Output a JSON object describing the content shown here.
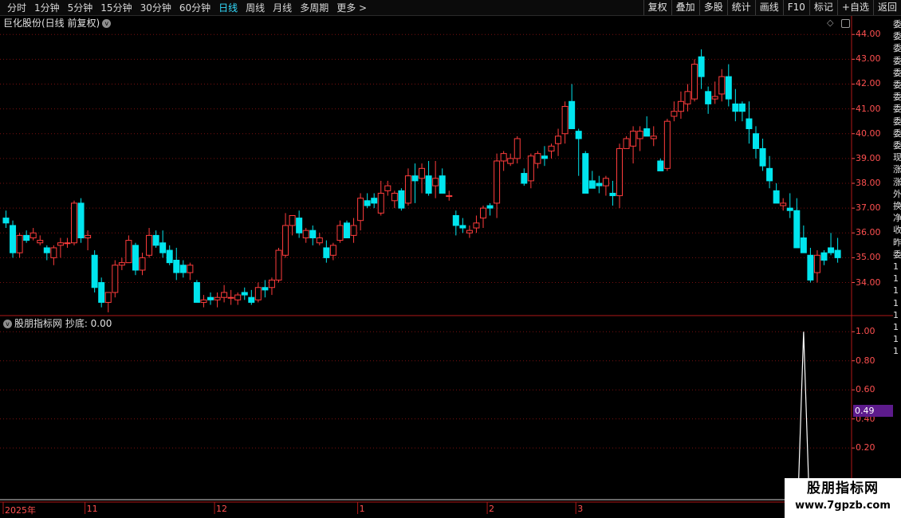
{
  "toolbar": {
    "periods": [
      "分时",
      "1分钟",
      "5分钟",
      "15分钟",
      "30分钟",
      "60分钟",
      "日线",
      "周线",
      "月线",
      "多周期",
      "更多"
    ],
    "active_period": "日线",
    "more_arrow": ">",
    "buttons": [
      "复权",
      "叠加",
      "多股",
      "统计",
      "画线",
      "F10",
      "标记",
      "+自选",
      "返回"
    ]
  },
  "main_chart": {
    "title": "巨化股份(日线 前复权)",
    "chevron": "v"
  },
  "indicator": {
    "title": "股朋指标网 抄底: 0.00",
    "current_value": "0.49"
  },
  "colors": {
    "up": "#ff3c3c",
    "down": "#00e5ee",
    "grid": "#7a1010",
    "axis_text": "#ff5050",
    "line": "#ffffff"
  },
  "watermark": {
    "line1": "股朋指标网",
    "line2": "www.7gpzb.com"
  },
  "side_fragments": [
    "委",
    "委",
    "委",
    "委",
    "委",
    "委",
    "委",
    "委",
    "委",
    "委",
    "委",
    "现",
    "涨",
    "涨",
    "外",
    "换",
    "净",
    "收",
    "昨",
    "委",
    "1",
    "1",
    "1",
    "1",
    "1",
    "1",
    "1",
    "1"
  ],
  "chart_data": [
    {
      "type": "candlestick",
      "title": "巨化股份(日线 前复权)",
      "y_ticks": [
        34.0,
        35.0,
        36.0,
        37.0,
        38.0,
        39.0,
        40.0,
        41.0,
        42.0,
        43.0,
        44.0
      ],
      "ylim": [
        32.7,
        44.2
      ],
      "x_labels": [
        "2025年",
        "11",
        "12",
        "1",
        "2",
        "3"
      ],
      "x_label_index": [
        0,
        12,
        31,
        52,
        71,
        84
      ],
      "candles": [
        [
          36.6,
          36.9,
          36.2,
          36.4
        ],
        [
          36.3,
          36.5,
          35.0,
          35.2
        ],
        [
          35.2,
          36.0,
          35.0,
          35.9
        ],
        [
          35.9,
          36.1,
          35.6,
          35.7
        ],
        [
          35.8,
          36.2,
          35.7,
          36.0
        ],
        [
          35.6,
          35.9,
          35.5,
          35.7
        ],
        [
          35.4,
          35.5,
          34.9,
          35.2
        ],
        [
          35.0,
          35.5,
          34.7,
          35.4
        ],
        [
          35.5,
          35.8,
          35.0,
          35.6
        ],
        [
          35.6,
          35.8,
          35.4,
          35.6
        ],
        [
          35.6,
          37.3,
          35.5,
          37.2
        ],
        [
          37.2,
          37.4,
          35.6,
          35.8
        ],
        [
          35.8,
          36.1,
          35.3,
          35.9
        ],
        [
          35.1,
          35.3,
          33.6,
          33.8
        ],
        [
          34.0,
          34.2,
          33.0,
          33.2
        ],
        [
          33.2,
          33.4,
          32.8,
          33.6
        ],
        [
          33.6,
          34.9,
          33.4,
          34.7
        ],
        [
          34.7,
          35.0,
          34.5,
          34.8
        ],
        [
          34.8,
          35.9,
          34.8,
          35.7
        ],
        [
          35.5,
          35.6,
          34.3,
          34.5
        ],
        [
          34.5,
          35.2,
          34.3,
          35.0
        ],
        [
          35.1,
          36.2,
          35.0,
          35.9
        ],
        [
          35.9,
          36.1,
          35.4,
          35.5
        ],
        [
          35.6,
          36.1,
          35.0,
          35.2
        ],
        [
          35.3,
          35.5,
          34.7,
          34.8
        ],
        [
          34.9,
          35.4,
          34.1,
          34.4
        ],
        [
          34.7,
          34.9,
          34.2,
          34.4
        ],
        [
          34.4,
          34.8,
          34.1,
          34.7
        ],
        [
          34.0,
          34.1,
          33.2,
          33.2
        ],
        [
          33.2,
          33.5,
          33.0,
          33.3
        ],
        [
          33.4,
          33.6,
          33.1,
          33.3
        ],
        [
          33.3,
          33.6,
          33.0,
          33.4
        ],
        [
          33.4,
          33.9,
          33.2,
          33.6
        ],
        [
          33.4,
          33.7,
          33.1,
          33.4
        ],
        [
          33.3,
          33.6,
          33.1,
          33.5
        ],
        [
          33.6,
          33.8,
          33.3,
          33.5
        ],
        [
          33.4,
          33.7,
          33.1,
          33.2
        ],
        [
          33.3,
          34.0,
          33.2,
          33.8
        ],
        [
          33.8,
          34.1,
          33.4,
          33.7
        ],
        [
          33.8,
          34.2,
          33.5,
          34.1
        ],
        [
          34.1,
          35.4,
          34.0,
          35.3
        ],
        [
          35.1,
          36.8,
          35.0,
          36.3
        ],
        [
          36.3,
          36.7,
          35.9,
          36.7
        ],
        [
          36.6,
          36.9,
          35.8,
          36.0
        ],
        [
          35.8,
          36.2,
          35.6,
          36.1
        ],
        [
          36.1,
          36.3,
          35.5,
          35.8
        ],
        [
          35.6,
          36.0,
          35.5,
          35.8
        ],
        [
          35.4,
          35.7,
          34.8,
          35.0
        ],
        [
          35.1,
          35.6,
          34.9,
          35.5
        ],
        [
          35.7,
          36.5,
          35.6,
          36.3
        ],
        [
          36.4,
          36.5,
          35.8,
          35.8
        ],
        [
          35.9,
          36.6,
          35.6,
          36.3
        ],
        [
          36.5,
          37.6,
          36.1,
          37.4
        ],
        [
          37.3,
          37.6,
          37.0,
          37.1
        ],
        [
          37.4,
          37.6,
          37.0,
          37.2
        ],
        [
          36.8,
          38.1,
          36.7,
          37.6
        ],
        [
          37.7,
          38.1,
          37.5,
          37.9
        ],
        [
          37.3,
          37.7,
          37.0,
          37.6
        ],
        [
          37.7,
          37.8,
          36.9,
          37.0
        ],
        [
          37.2,
          38.6,
          37.1,
          38.3
        ],
        [
          38.3,
          38.8,
          37.2,
          38.1
        ],
        [
          38.2,
          38.8,
          37.6,
          38.6
        ],
        [
          38.3,
          38.9,
          37.5,
          37.6
        ],
        [
          37.9,
          38.9,
          37.4,
          38.2
        ],
        [
          38.3,
          38.6,
          37.6,
          37.6
        ],
        [
          37.5,
          37.7,
          37.3,
          37.5
        ],
        [
          36.7,
          36.9,
          35.9,
          36.3
        ],
        [
          36.3,
          36.6,
          36.0,
          36.2
        ],
        [
          36.0,
          36.3,
          35.8,
          36.1
        ],
        [
          36.2,
          36.7,
          36.0,
          36.4
        ],
        [
          36.6,
          37.1,
          36.2,
          37.0
        ],
        [
          37.1,
          37.2,
          36.7,
          37.0
        ],
        [
          37.2,
          39.2,
          36.6,
          38.9
        ],
        [
          38.9,
          39.3,
          38.5,
          39.2
        ],
        [
          38.8,
          39.2,
          38.7,
          39.0
        ],
        [
          39.0,
          39.9,
          38.8,
          39.8
        ],
        [
          38.4,
          38.6,
          37.9,
          38.0
        ],
        [
          38.1,
          39.2,
          37.8,
          39.1
        ],
        [
          38.8,
          39.3,
          38.6,
          39.2
        ],
        [
          39.1,
          39.5,
          38.7,
          39.0
        ],
        [
          39.3,
          39.6,
          39.0,
          39.5
        ],
        [
          39.6,
          40.2,
          39.1,
          39.9
        ],
        [
          40.0,
          41.3,
          39.6,
          41.1
        ],
        [
          41.3,
          42.0,
          41.2,
          40.2
        ],
        [
          40.1,
          40.2,
          38.3,
          39.8
        ],
        [
          39.2,
          39.3,
          37.6,
          37.6
        ],
        [
          38.1,
          38.5,
          37.9,
          37.8
        ],
        [
          38.0,
          38.3,
          37.6,
          37.9
        ],
        [
          37.9,
          38.3,
          37.5,
          38.2
        ],
        [
          37.6,
          38.1,
          37.1,
          37.5
        ],
        [
          37.5,
          39.6,
          37.0,
          39.4
        ],
        [
          39.4,
          39.9,
          39.4,
          39.8
        ],
        [
          39.5,
          40.3,
          38.8,
          40.1
        ],
        [
          39.8,
          40.3,
          39.3,
          40.1
        ],
        [
          40.2,
          40.7,
          39.9,
          39.9
        ],
        [
          39.8,
          40.3,
          39.5,
          39.9
        ],
        [
          38.9,
          39.0,
          38.5,
          38.5
        ],
        [
          38.6,
          40.6,
          38.5,
          40.5
        ],
        [
          40.7,
          41.3,
          40.5,
          40.9
        ],
        [
          40.9,
          41.7,
          40.6,
          41.3
        ],
        [
          41.2,
          42.0,
          40.9,
          41.7
        ],
        [
          41.4,
          43.0,
          41.3,
          42.8
        ],
        [
          43.1,
          43.4,
          41.8,
          42.3
        ],
        [
          41.7,
          41.9,
          40.8,
          41.2
        ],
        [
          41.4,
          42.1,
          41.2,
          41.5
        ],
        [
          41.6,
          42.6,
          41.3,
          42.3
        ],
        [
          42.3,
          42.8,
          41.1,
          41.4
        ],
        [
          41.2,
          41.8,
          40.5,
          40.9
        ],
        [
          41.2,
          41.3,
          40.5,
          40.9
        ],
        [
          40.6,
          41.3,
          39.6,
          40.2
        ],
        [
          40.0,
          40.3,
          39.0,
          39.4
        ],
        [
          39.4,
          39.8,
          38.5,
          38.7
        ],
        [
          38.6,
          39.1,
          37.8,
          38.1
        ],
        [
          37.7,
          38.0,
          37.3,
          37.2
        ],
        [
          37.1,
          37.4,
          36.9,
          37.2
        ],
        [
          37.0,
          37.6,
          36.6,
          36.9
        ],
        [
          36.9,
          37.4,
          36.0,
          35.4
        ],
        [
          35.8,
          36.3,
          35.3,
          35.2
        ],
        [
          35.1,
          35.4,
          34.0,
          34.1
        ],
        [
          34.4,
          35.3,
          34.0,
          35.1
        ],
        [
          35.2,
          35.3,
          34.7,
          34.9
        ],
        [
          35.4,
          36.0,
          35.1,
          35.2
        ],
        [
          35.3,
          35.8,
          34.8,
          35.0
        ]
      ]
    },
    {
      "type": "line",
      "title": "股朋指标网 抄底: 0.00",
      "y_ticks": [
        0.2,
        0.4,
        0.6,
        0.8,
        1.0
      ],
      "ylim": [
        -0.15,
        1.1
      ],
      "series": [
        {
          "peak_index": 117,
          "peak_value": 1.0
        }
      ]
    }
  ]
}
